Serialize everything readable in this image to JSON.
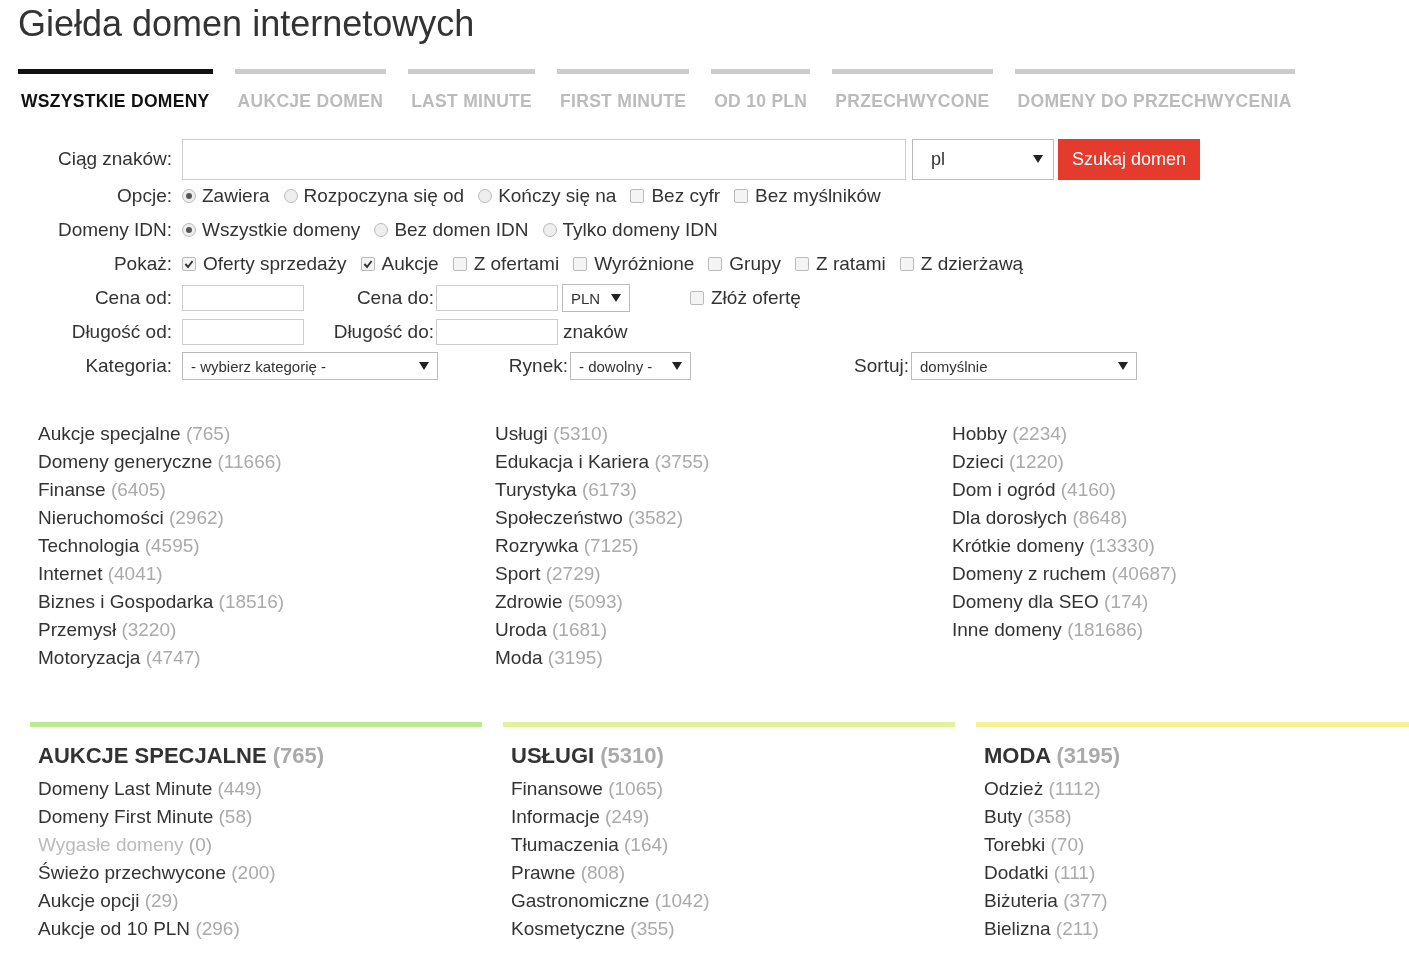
{
  "page_title": "Giełda domen internetowych",
  "tabs": [
    {
      "label": "WSZYSTKIE DOMENY",
      "selected": true
    },
    {
      "label": "AUKCJE DOMEN",
      "selected": false
    },
    {
      "label": "LAST MINUTE",
      "selected": false
    },
    {
      "label": "FIRST MINUTE",
      "selected": false
    },
    {
      "label": "OD 10 PLN",
      "selected": false
    },
    {
      "label": "PRZECHWYCONE",
      "selected": false
    },
    {
      "label": "DOMENY DO PRZECHWYCENIA",
      "selected": false
    }
  ],
  "search": {
    "label": "Ciąg znaków:",
    "tld": "pl",
    "button": "Szukaj domen"
  },
  "option_rows": [
    {
      "label": "Opcje:",
      "items": [
        {
          "kind": "radio",
          "label": "Zawiera",
          "checked": true
        },
        {
          "kind": "radio",
          "label": "Rozpoczyna się od",
          "checked": false
        },
        {
          "kind": "radio",
          "label": "Kończy się na",
          "checked": false
        },
        {
          "kind": "checkbox",
          "label": "Bez cyfr",
          "checked": false
        },
        {
          "kind": "checkbox",
          "label": "Bez myślników",
          "checked": false
        }
      ]
    },
    {
      "label": "Domeny IDN:",
      "items": [
        {
          "kind": "radio",
          "label": "Wszystkie domeny",
          "checked": true
        },
        {
          "kind": "radio",
          "label": "Bez domen IDN",
          "checked": false
        },
        {
          "kind": "radio",
          "label": "Tylko domeny IDN",
          "checked": false
        }
      ]
    },
    {
      "label": "Pokaż:",
      "items": [
        {
          "kind": "checkbox",
          "label": "Oferty sprzedaży",
          "checked": true
        },
        {
          "kind": "checkbox",
          "label": "Aukcje",
          "checked": true
        },
        {
          "kind": "checkbox",
          "label": "Z ofertami",
          "checked": false
        },
        {
          "kind": "checkbox",
          "label": "Wyróżnione",
          "checked": false
        },
        {
          "kind": "checkbox",
          "label": "Grupy",
          "checked": false
        },
        {
          "kind": "checkbox",
          "label": "Z ratami",
          "checked": false
        },
        {
          "kind": "checkbox",
          "label": "Z dzierżawą",
          "checked": false
        }
      ]
    }
  ],
  "price": {
    "label_from": "Cena od:",
    "label_to": "Cena do:",
    "currency": "PLN",
    "offer": {
      "label": "Złóż ofertę",
      "checked": false
    }
  },
  "length": {
    "label_from": "Długość od:",
    "label_to": "Długość do:",
    "unit": "znaków"
  },
  "filters": {
    "category_label": "Kategoria:",
    "category": "- wybierz kategorię -",
    "market_label": "Rynek:",
    "market": "- dowolny -",
    "sort_label": "Sortuj:",
    "sort": "domyślnie"
  },
  "category_columns": [
    [
      {
        "name": "Aukcje specjalne",
        "count": "(765)"
      },
      {
        "name": "Domeny generyczne",
        "count": "(11666)"
      },
      {
        "name": "Finanse",
        "count": "(6405)"
      },
      {
        "name": "Nieruchomości",
        "count": "(2962)"
      },
      {
        "name": "Technologia",
        "count": "(4595)"
      },
      {
        "name": "Internet",
        "count": "(4041)"
      },
      {
        "name": "Biznes i Gospodarka",
        "count": "(18516)"
      },
      {
        "name": "Przemysł",
        "count": "(3220)"
      },
      {
        "name": "Motoryzacja",
        "count": "(4747)"
      }
    ],
    [
      {
        "name": "Usługi",
        "count": "(5310)"
      },
      {
        "name": "Edukacja i Kariera",
        "count": "(3755)"
      },
      {
        "name": "Turystyka",
        "count": "(6173)"
      },
      {
        "name": "Społeczeństwo",
        "count": "(3582)"
      },
      {
        "name": "Rozrywka",
        "count": "(7125)"
      },
      {
        "name": "Sport",
        "count": "(2729)"
      },
      {
        "name": "Zdrowie",
        "count": "(5093)"
      },
      {
        "name": "Uroda",
        "count": "(1681)"
      },
      {
        "name": "Moda",
        "count": "(3195)"
      }
    ],
    [
      {
        "name": "Hobby",
        "count": "(2234)"
      },
      {
        "name": "Dzieci",
        "count": "(1220)"
      },
      {
        "name": "Dom i ogród",
        "count": "(4160)"
      },
      {
        "name": "Dla dorosłych",
        "count": "(8648)"
      },
      {
        "name": "Krótkie domeny",
        "count": "(13330)"
      },
      {
        "name": "Domeny z ruchem",
        "count": "(40687)"
      },
      {
        "name": "Domeny dla SEO",
        "count": "(174)"
      },
      {
        "name": "Inne domeny",
        "count": "(181686)"
      }
    ]
  ],
  "sections": [
    {
      "title": "AUKCJE SPECJALNE",
      "count": "(765)",
      "color": "#b9ec8e",
      "items": [
        {
          "name": "Domeny Last Minute",
          "count": "(449)",
          "disabled": false
        },
        {
          "name": "Domeny First Minute",
          "count": "(58)",
          "disabled": false
        },
        {
          "name": "Wygasłe domeny",
          "count": "(0)",
          "disabled": true
        },
        {
          "name": "Świeżo przechwycone",
          "count": "(200)",
          "disabled": false
        },
        {
          "name": "Aukcje opcji",
          "count": "(29)",
          "disabled": false
        },
        {
          "name": "Aukcje od 10 PLN",
          "count": "(296)",
          "disabled": false
        }
      ]
    },
    {
      "title": "USŁUGI",
      "count": "(5310)",
      "color": "#e2f29b",
      "items": [
        {
          "name": "Finansowe",
          "count": "(1065)",
          "disabled": false
        },
        {
          "name": "Informacje",
          "count": "(249)",
          "disabled": false
        },
        {
          "name": "Tłumaczenia",
          "count": "(164)",
          "disabled": false
        },
        {
          "name": "Prawne",
          "count": "(808)",
          "disabled": false
        },
        {
          "name": "Gastronomiczne",
          "count": "(1042)",
          "disabled": false
        },
        {
          "name": "Kosmetyczne",
          "count": "(355)",
          "disabled": false
        }
      ]
    },
    {
      "title": "MODA",
      "count": "(3195)",
      "color": "#f8f096",
      "items": [
        {
          "name": "Odzież",
          "count": "(1112)",
          "disabled": false
        },
        {
          "name": "Buty",
          "count": "(358)",
          "disabled": false
        },
        {
          "name": "Torebki",
          "count": "(70)",
          "disabled": false
        },
        {
          "name": "Dodatki",
          "count": "(111)",
          "disabled": false
        },
        {
          "name": "Biżuteria",
          "count": "(377)",
          "disabled": false
        },
        {
          "name": "Bielizna",
          "count": "(211)",
          "disabled": false
        }
      ]
    }
  ]
}
